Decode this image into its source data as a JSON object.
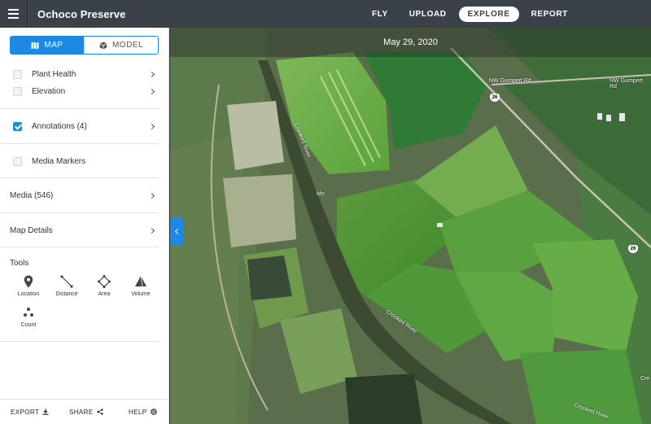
{
  "app": {
    "title": "Ochoco Preserve"
  },
  "nav": [
    {
      "label": "FLY",
      "active": false
    },
    {
      "label": "UPLOAD",
      "active": false
    },
    {
      "label": "EXPLORE",
      "active": true
    },
    {
      "label": "REPORT",
      "active": false
    }
  ],
  "view_toggle": {
    "map_label": "MAP",
    "model_label": "MODEL",
    "selected": "MAP"
  },
  "layers": {
    "plant_health": {
      "label": "Plant Health",
      "checked": false
    },
    "elevation": {
      "label": "Elevation",
      "checked": false
    },
    "annotations": {
      "label": "Annotations (4)",
      "checked": true
    },
    "media_markers": {
      "label": "Media Markers",
      "checked": false
    }
  },
  "sections": {
    "media": "Media (546)",
    "map_details": "Map Details"
  },
  "tools": {
    "title": "Tools",
    "location": "Location",
    "distance": "Distance",
    "area": "Area",
    "volume": "Volume",
    "count": "Count"
  },
  "footer": {
    "export": "EXPORT",
    "share": "SHARE",
    "help": "HELP"
  },
  "map": {
    "date": "May 29, 2020",
    "road_label_1": "NW Gumpert Rd",
    "road_label_2": "NW Gumpert Rd",
    "river_label_1": "Crooked River",
    "river_label_2": "Crooked River",
    "river_label_3": "Crooked River",
    "route_26": "26",
    "place_label_mo": "Mo",
    "place_label_cre": "Cre"
  },
  "colors": {
    "accent": "#1e88e5",
    "topbar": "#3b4149"
  }
}
